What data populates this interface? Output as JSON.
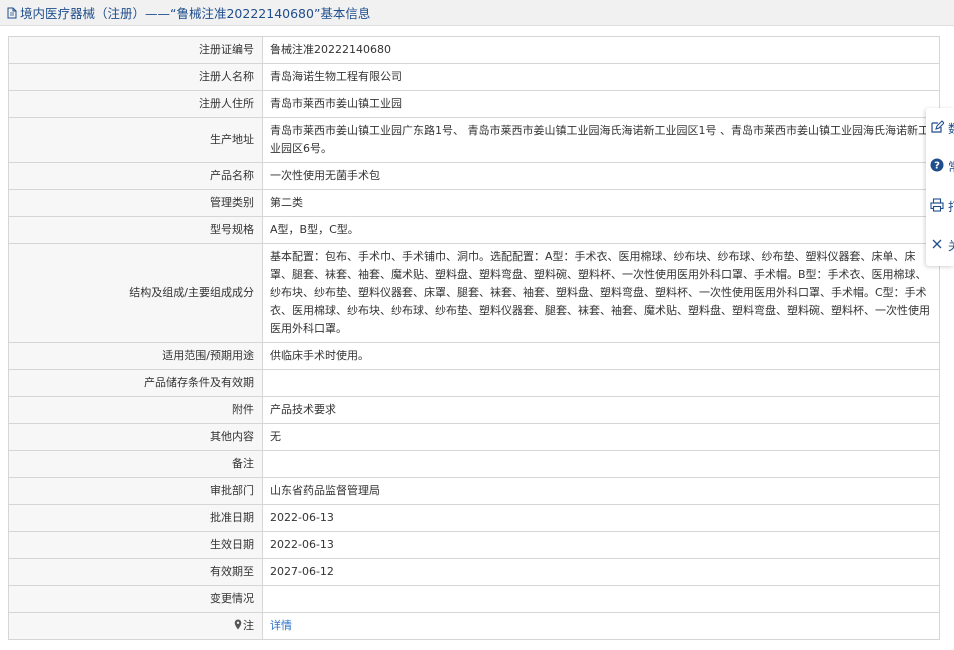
{
  "header": {
    "title": "境内医疗器械（注册）——“鲁械注准20222140680”基本信息"
  },
  "rows": [
    {
      "label": "注册证编号",
      "value": "鲁械注准20222140680"
    },
    {
      "label": "注册人名称",
      "value": "青岛海诺生物工程有限公司"
    },
    {
      "label": "注册人住所",
      "value": "青岛市莱西市姜山镇工业园"
    },
    {
      "label": "生产地址",
      "value": "青岛市莱西市姜山镇工业园广东路1号、 青岛市莱西市姜山镇工业园海氏海诺新工业园区1号 、青岛市莱西市姜山镇工业园海氏海诺新工业园区6号。"
    },
    {
      "label": "产品名称",
      "value": "一次性使用无菌手术包"
    },
    {
      "label": "管理类别",
      "value": "第二类"
    },
    {
      "label": "型号规格",
      "value": "A型，B型，C型。"
    },
    {
      "label": "结构及组成/主要组成成分",
      "value": "基本配置：包布、手术巾、手术铺巾、洞巾。选配配置：A型：手术衣、医用棉球、纱布块、纱布球、纱布垫、塑料仪器套、床单、床罩、腿套、袜套、袖套、魔术贴、塑料盘、塑料弯盘、塑料碗、塑料杯、一次性使用医用外科口罩、手术帽。B型：手术衣、医用棉球、纱布块、纱布垫、塑料仪器套、床罩、腿套、袜套、袖套、塑料盘、塑料弯盘、塑料杯、一次性使用医用外科口罩、手术帽。C型：手术衣、医用棉球、纱布块、纱布球、纱布垫、塑料仪器套、腿套、袜套、袖套、魔术贴、塑料盘、塑料弯盘、塑料碗、塑料杯、一次性使用医用外科口罩。"
    },
    {
      "label": "适用范围/预期用途",
      "value": "供临床手术时使用。"
    },
    {
      "label": "产品储存条件及有效期",
      "value": ""
    },
    {
      "label": "附件",
      "value": "产品技术要求"
    },
    {
      "label": "其他内容",
      "value": "无"
    },
    {
      "label": "备注",
      "value": ""
    },
    {
      "label": "审批部门",
      "value": "山东省药品监督管理局"
    },
    {
      "label": "批准日期",
      "value": "2022-06-13"
    },
    {
      "label": "生效日期",
      "value": "2022-06-13"
    },
    {
      "label": "有效期至",
      "value": "2027-06-12"
    },
    {
      "label": "变更情况",
      "value": ""
    }
  ],
  "note_row": {
    "label": "注",
    "link_text": "详情"
  },
  "side_panel": {
    "buttons": [
      {
        "icon": "edit-icon",
        "label": "数"
      },
      {
        "icon": "help-icon",
        "label": "常"
      },
      {
        "icon": "print-icon",
        "label": "打"
      },
      {
        "icon": "close-icon",
        "label": "关"
      }
    ]
  },
  "colors": {
    "title": "#1f4e8c",
    "link": "#2a6fc9",
    "label_bg": "#f7f7f7",
    "border": "#d6d6d6"
  }
}
